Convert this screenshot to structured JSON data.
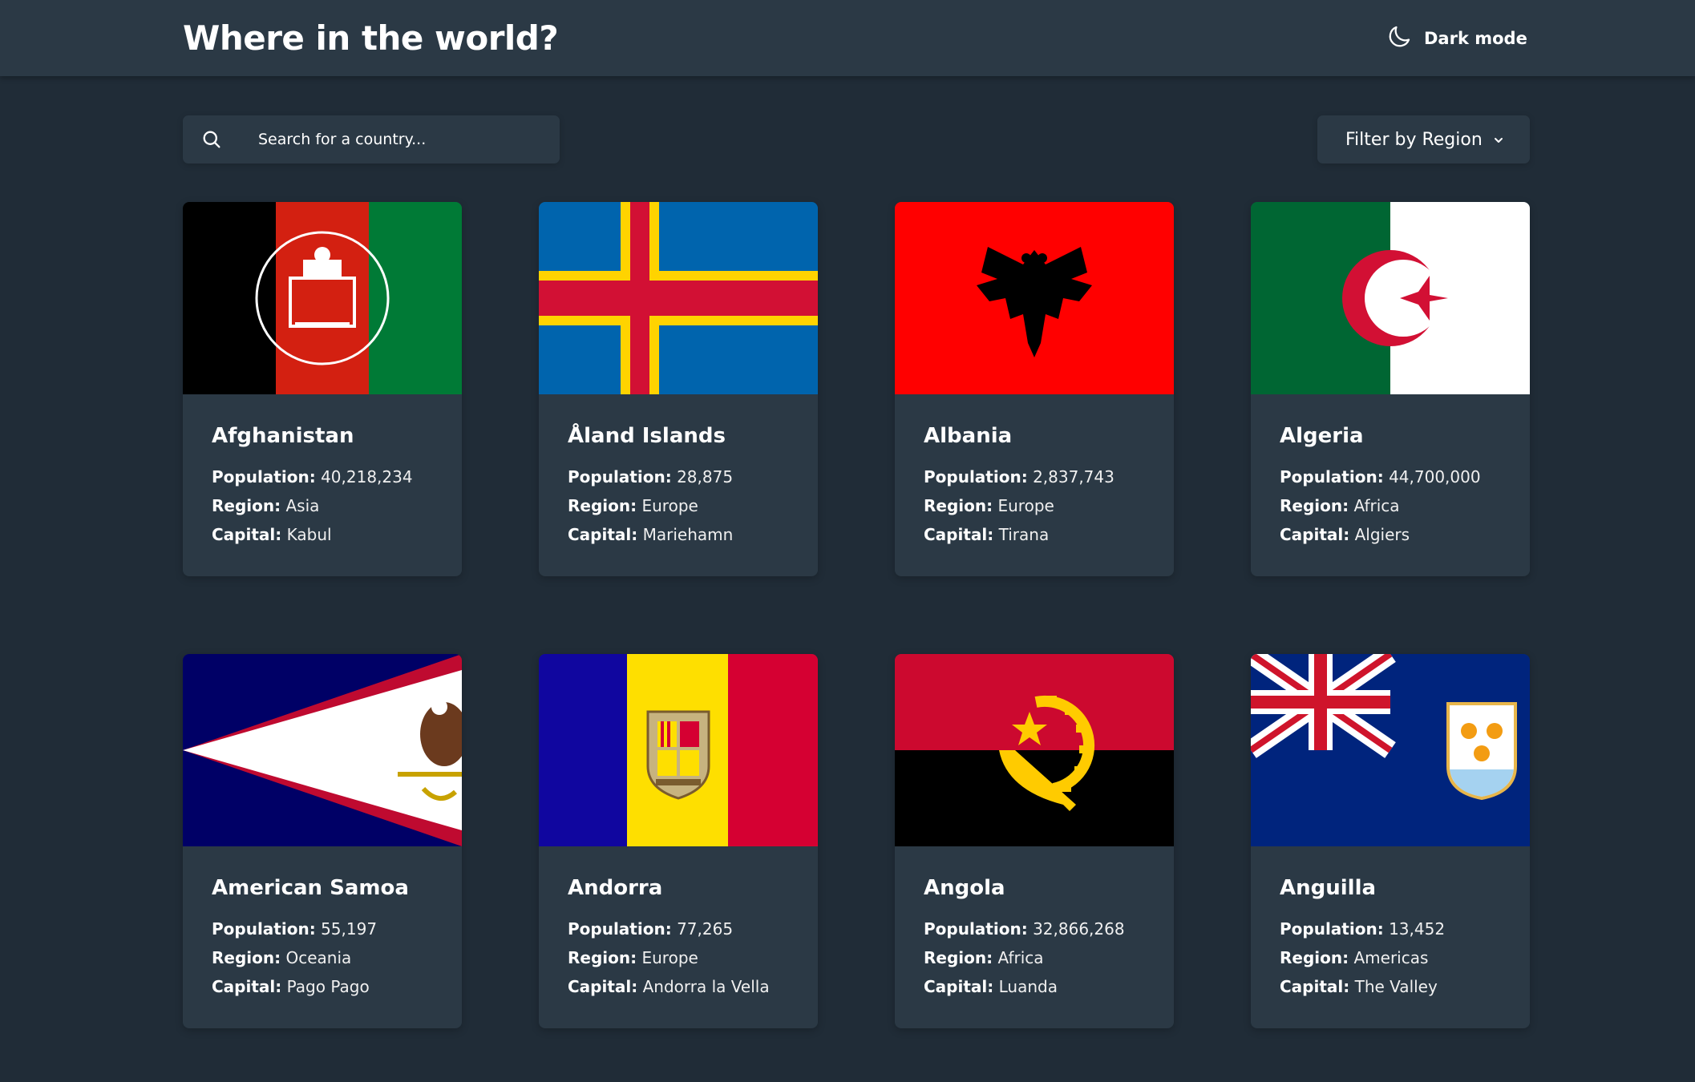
{
  "header": {
    "title": "Where in the world?",
    "theme_toggle_label": "Dark mode",
    "theme_toggle_icon": "moon-icon"
  },
  "search": {
    "placeholder": "Search for a country...",
    "value": "",
    "icon": "search-icon"
  },
  "filter": {
    "label": "Filter by Region",
    "icon": "chevron-down-icon"
  },
  "labels": {
    "population": "Population:",
    "region": "Region:",
    "capital": "Capital:"
  },
  "countries": [
    {
      "name": "Afghanistan",
      "population": "40,218,234",
      "region": "Asia",
      "capital": "Kabul",
      "flag": "afghanistan-flag"
    },
    {
      "name": "Åland Islands",
      "population": "28,875",
      "region": "Europe",
      "capital": "Mariehamn",
      "flag": "aland-islands-flag"
    },
    {
      "name": "Albania",
      "population": "2,837,743",
      "region": "Europe",
      "capital": "Tirana",
      "flag": "albania-flag"
    },
    {
      "name": "Algeria",
      "population": "44,700,000",
      "region": "Africa",
      "capital": "Algiers",
      "flag": "algeria-flag"
    },
    {
      "name": "American Samoa",
      "population": "55,197",
      "region": "Oceania",
      "capital": "Pago Pago",
      "flag": "american-samoa-flag"
    },
    {
      "name": "Andorra",
      "population": "77,265",
      "region": "Europe",
      "capital": "Andorra la Vella",
      "flag": "andorra-flag"
    },
    {
      "name": "Angola",
      "population": "32,866,268",
      "region": "Africa",
      "capital": "Luanda",
      "flag": "angola-flag"
    },
    {
      "name": "Anguilla",
      "population": "13,452",
      "region": "Americas",
      "capital": "The Valley",
      "flag": "anguilla-flag"
    }
  ],
  "colors": {
    "background": "#202c37",
    "surface": "#2b3945",
    "text": "#ffffff"
  }
}
